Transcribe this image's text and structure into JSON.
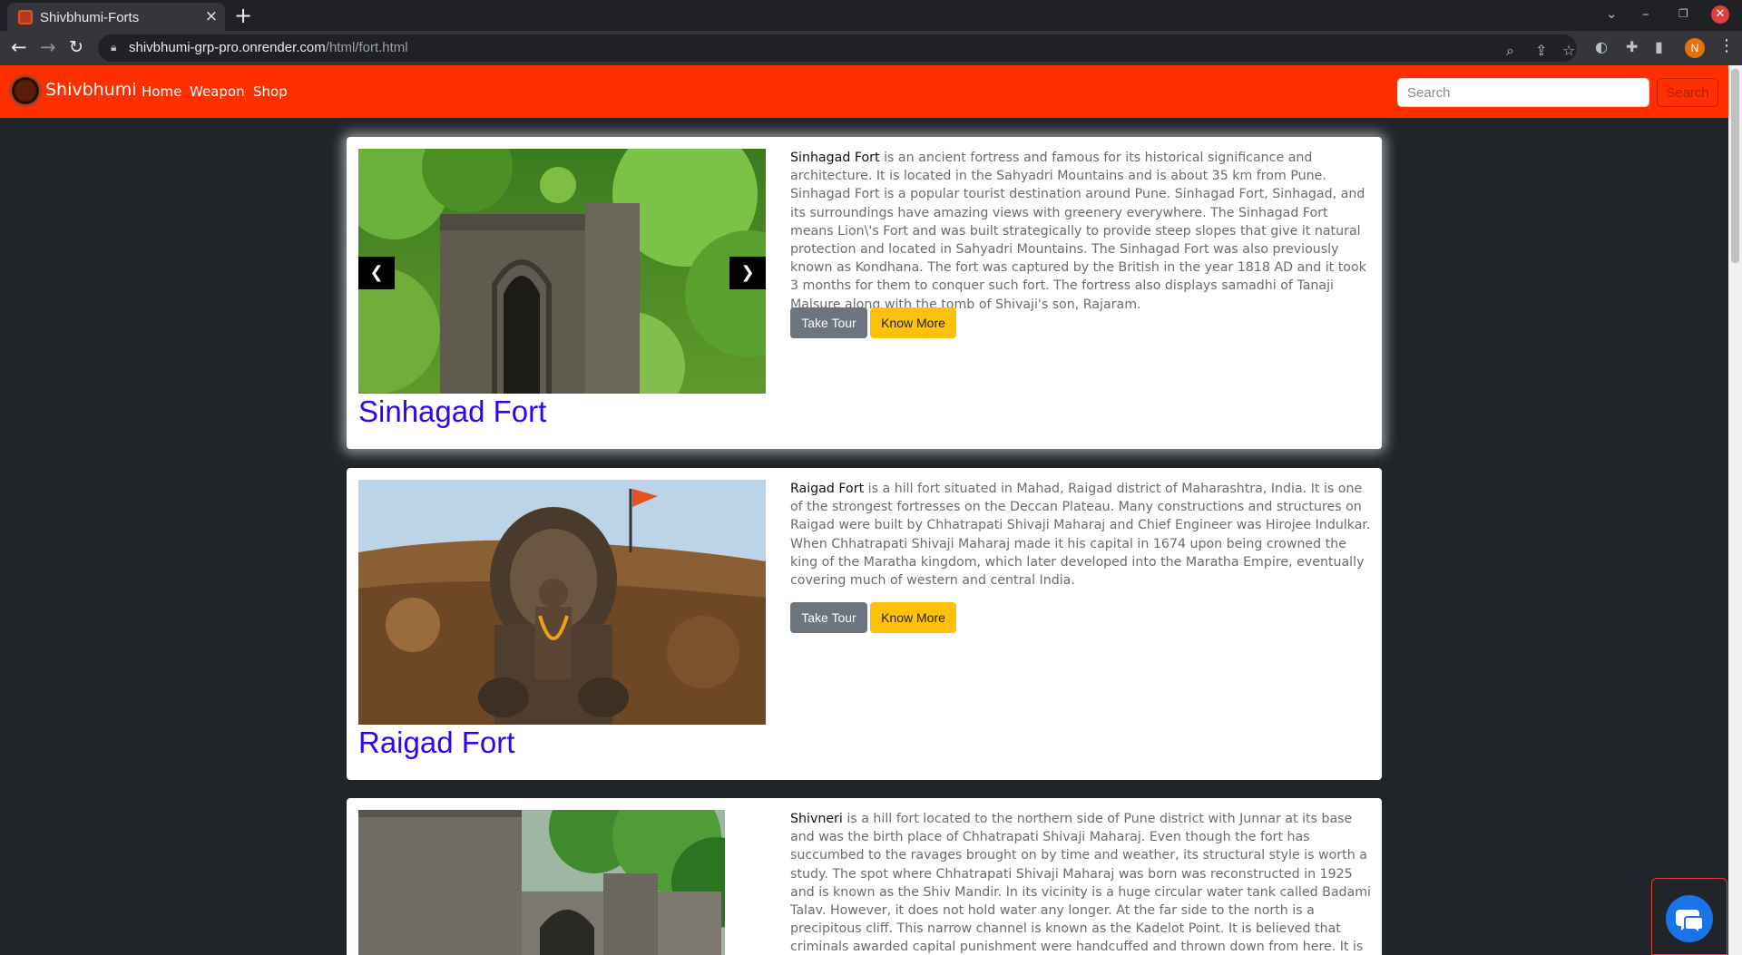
{
  "browser": {
    "tab_title": "Shivbhumi-Forts",
    "tab_close": "×",
    "new_tab": "+",
    "url_host": "shivbhumi-grp-pro.onrender.com",
    "url_path": "/html/fort.html",
    "profile_initial": "N",
    "icons": [
      "back-icon",
      "forward-icon",
      "reload-icon",
      "lock-icon",
      "zoom-icon",
      "share-icon",
      "star-icon",
      "extensions-icon",
      "sidepanel-icon",
      "menu-icon"
    ]
  },
  "navbar": {
    "brand": "Shivbhumi",
    "links": [
      "Home",
      "Weapon",
      "Shop"
    ],
    "search_placeholder": "Search",
    "search_button": "Search",
    "color": "#ff2f00"
  },
  "forts": [
    {
      "title": "Sinhagad Fort",
      "name": "Sinhagad Fort",
      "description": " is an ancient fortress and famous for its historical significance and architecture. It is located in the Sahyadri Mountains and is about 35 km from Pune. Sinhagad Fort is a popular tourist destination around Pune. Sinhagad Fort, Sinhagad, and its surroundings have amazing views with greenery everywhere. The Sinhagad Fort means Lion\\'s Fort and was built strategically to provide steep slopes that give it natural protection and located in Sahyadri Mountains. The Sinhagad Fort was also previously known as Kondhana. The fort was captured by the British in the year 1818 AD and it took 3 months for them to conquer such fort. The fortress also displays samadhi of Tanaji Malsure along with the tomb of Shivaji's son, Rajaram.",
      "tour_label": "Take Tour",
      "know_label": "Know More",
      "prev": "❮",
      "next": "❯"
    },
    {
      "title": "Raigad Fort",
      "name": "Raigad Fort",
      "description": " is a hill fort situated in Mahad, Raigad district of Maharashtra, India. It is one of the strongest fortresses on the Deccan Plateau. Many constructions and structures on Raigad were built by Chhatrapati Shivaji Maharaj and Chief Engineer was Hirojee Indulkar. When Chhatrapati Shivaji Maharaj made it his capital in 1674 upon being crowned the king of the Maratha kingdom, which later developed into the Maratha Empire, eventually covering much of western and central India.",
      "tour_label": "Take Tour",
      "know_label": "Know More"
    },
    {
      "title": "",
      "name": "Shivneri",
      "description": " is a hill fort located to the northern side of Pune district with Junnar at its base and was the birth place of Chhatrapati Shivaji Maharaj. Even though the fort has succumbed to the ravages brought on by time and weather, its structural style is worth a study. The spot where Chhatrapati Shivaji Maharaj was born was reconstructed in 1925 and is known as the Shiv Mandir. In its vicinity is a huge circular water tank called Badami Talav. However, it does not hold water any longer. At the far side to the north is a precipitous cliff. This narrow channel is known as the Kadelot Point. It is believed that criminals awarded capital punishment were handcuffed and thrown down from here. It is from here that one can get a good view of the Manikdoh Dam"
    }
  ]
}
